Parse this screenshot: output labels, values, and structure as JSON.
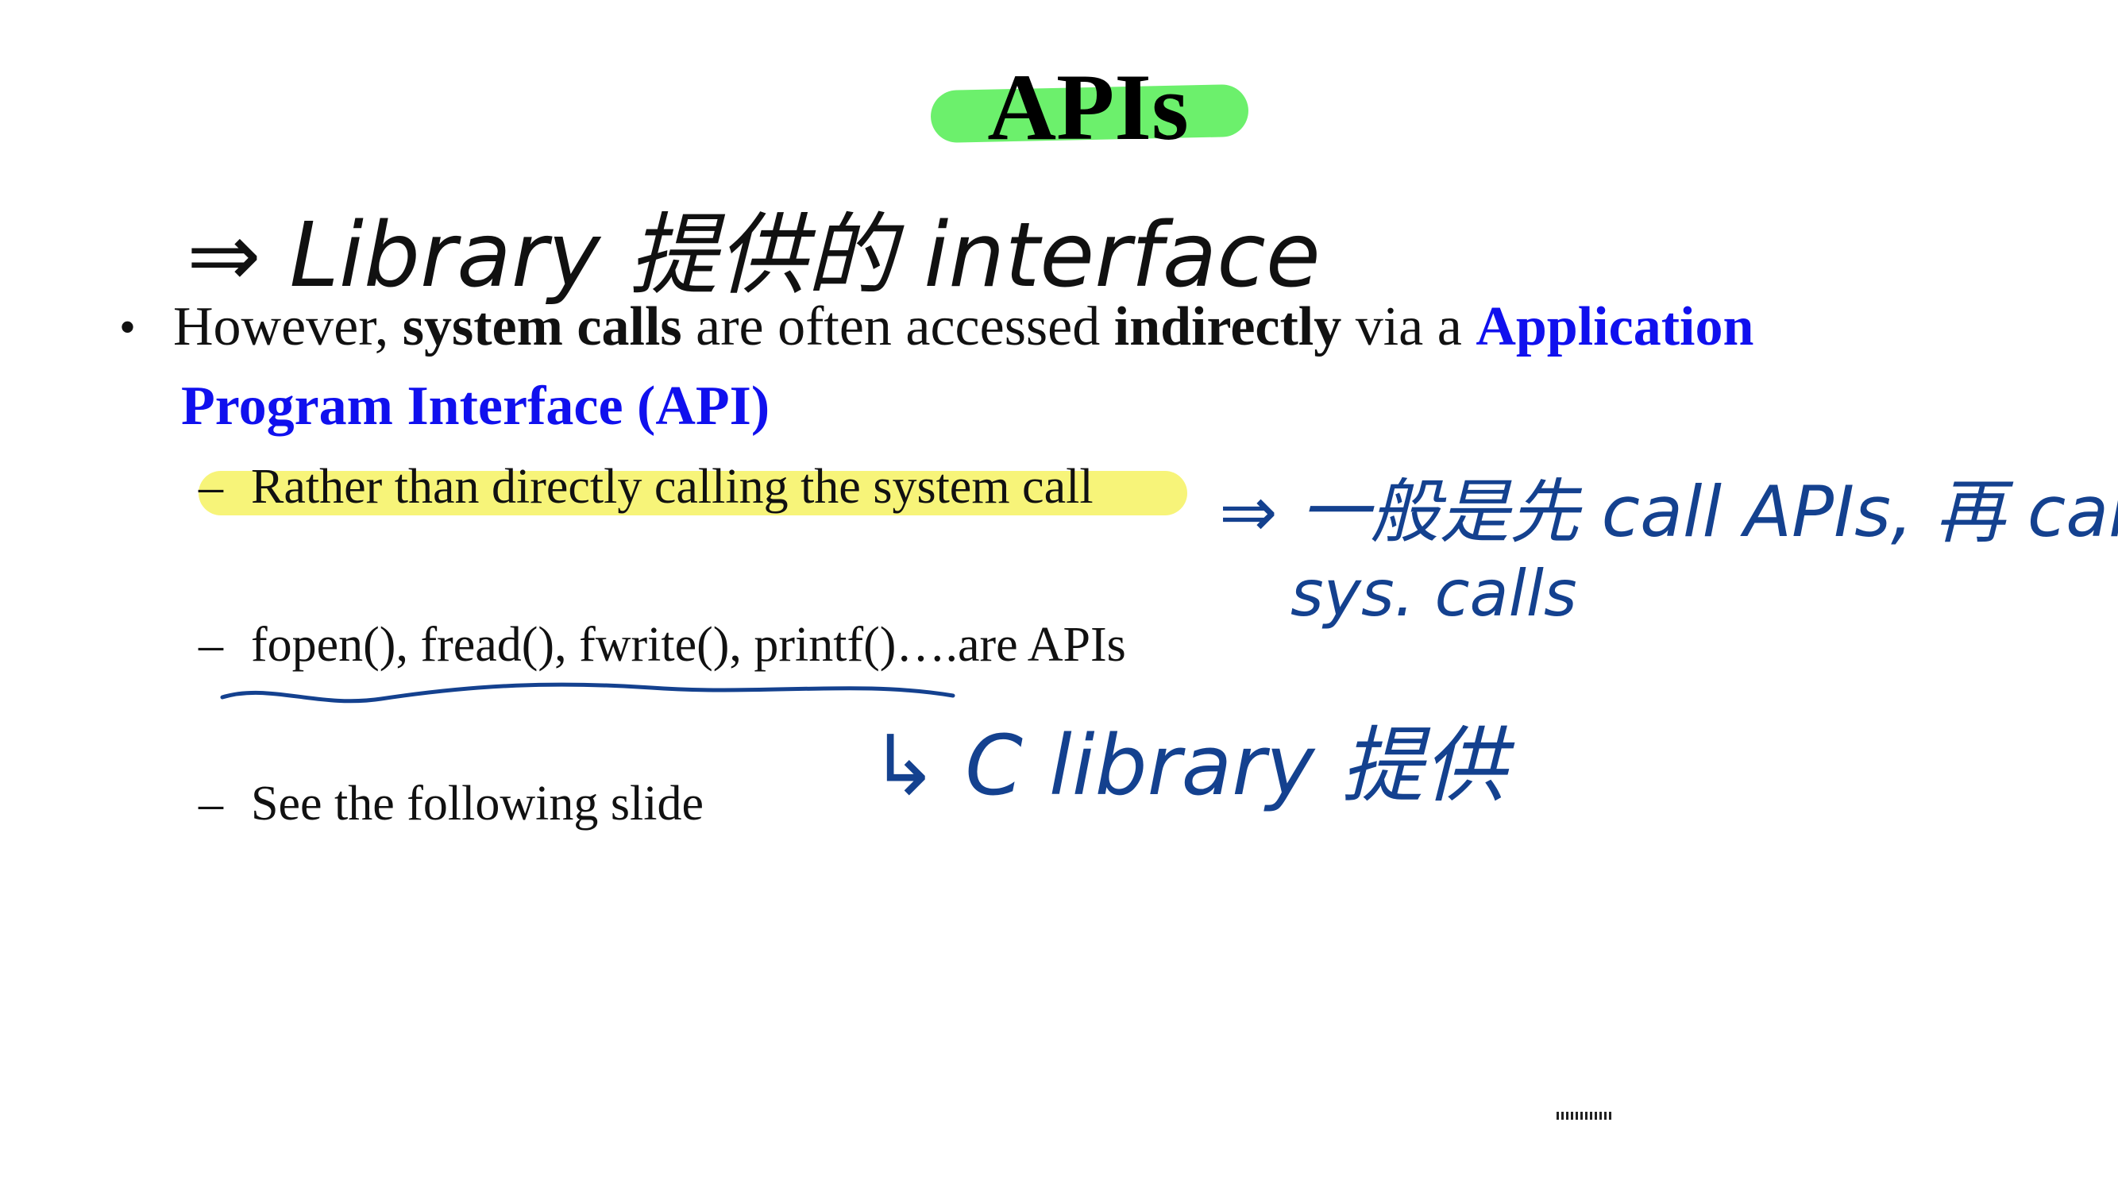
{
  "title": "APIs",
  "bullet": {
    "marker": "•",
    "part1": "However, ",
    "bold1": "system calls",
    "part2": " are often accessed ",
    "bold2": "indirectly",
    "part3": " via a ",
    "api_term_line1": "Application",
    "api_term_line2": "Program Interface (API)"
  },
  "sub_items": [
    {
      "dash": "–",
      "text": "Rather than directly calling the system call"
    },
    {
      "dash": "–",
      "text": "fopen(), fread(), fwrite(), printf()….are APIs"
    },
    {
      "dash": "–",
      "text": "See the following slide"
    }
  ],
  "handwritten_notes": {
    "top_note": "⇒ Library 提供的 interface",
    "right_note_line1": "⇒ 一般是先 call APIs, 再 call",
    "right_note_line2": "sys. calls",
    "bottom_note": "↳ C library 提供"
  },
  "colors": {
    "title_highlight": "#6cf06c",
    "sub_highlight": "#f6f36a",
    "api_term": "#1010ee",
    "ink_blue": "#14418f",
    "ink_black": "#111111"
  }
}
